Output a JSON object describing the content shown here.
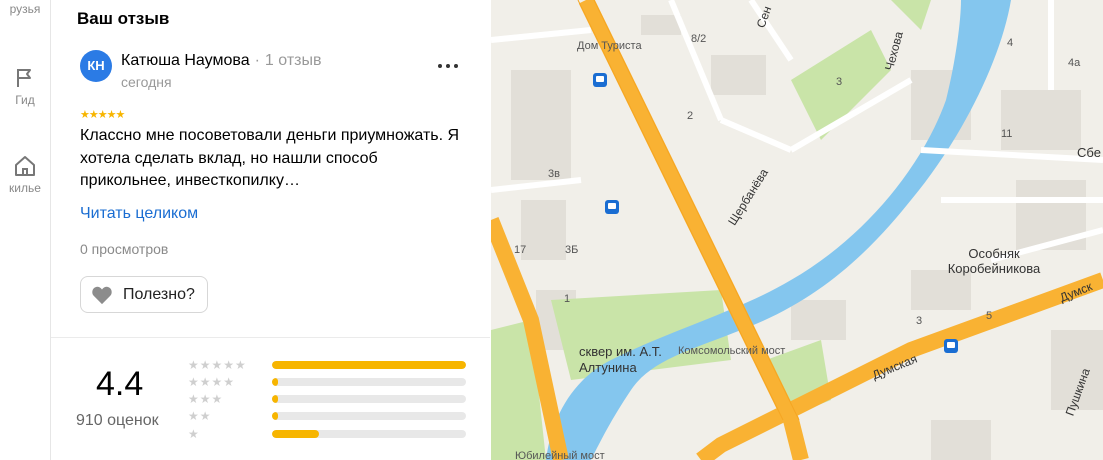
{
  "rail": {
    "items": [
      {
        "label": "рузья"
      },
      {
        "label": "Гид"
      },
      {
        "label": "килье"
      }
    ]
  },
  "panel": {
    "title": "Ваш отзыв",
    "review": {
      "avatar_initials": "КН",
      "author": "Катюша Наумова",
      "separator": "·",
      "reviews_count": "1 отзыв",
      "date": "сегодня",
      "stars": "★★★★★",
      "text": "Классно мне посоветовали деньги приумножать. Я хотела сделать вклад, но нашли способ прикольнее, инвесткопилку…",
      "read_more": "Читать целиком",
      "views": "0 просмотров",
      "useful_label": "Полезно?"
    },
    "summary": {
      "rating": "4.4",
      "count": "910 оценок",
      "distribution": [
        {
          "stars": "★★★★★",
          "fraction": 1.0
        },
        {
          "stars": "★★★★",
          "fraction": 0.03
        },
        {
          "stars": "★★★",
          "fraction": 0.03
        },
        {
          "stars": "★★",
          "fraction": 0.03
        },
        {
          "stars": "★",
          "fraction": 0.24
        }
      ]
    }
  },
  "map": {
    "labels": {
      "dom_turista": "Дом Туриста",
      "num_8_2": "8/2",
      "num_3": "3",
      "num_3v": "3в",
      "num_3b": "3Б",
      "num_17": "17",
      "num_1": "1",
      "num_2": "2",
      "num_4": "4",
      "num_4a": "4а",
      "num_11": "11",
      "num_5": "5",
      "num_3b2": "3",
      "sen": "Сен",
      "chekhova": "Чехова",
      "scherbaneva": "Щербанёва",
      "sbe": "Сбе",
      "osobnyak": "Особняк Коробейникова",
      "skver": "сквер им. А.Т. Алтунина",
      "komsomolsky": "Комсомольский мост",
      "dumskaya": "Думская",
      "dumsk": "Думск",
      "pushkina": "Пушкина",
      "yubileyny": "Юбилейный мост"
    },
    "colors": {
      "river": "#86c7ee",
      "road_major": "#f9b233",
      "park": "#c7e3a4",
      "building": "#e0ddd6"
    }
  }
}
